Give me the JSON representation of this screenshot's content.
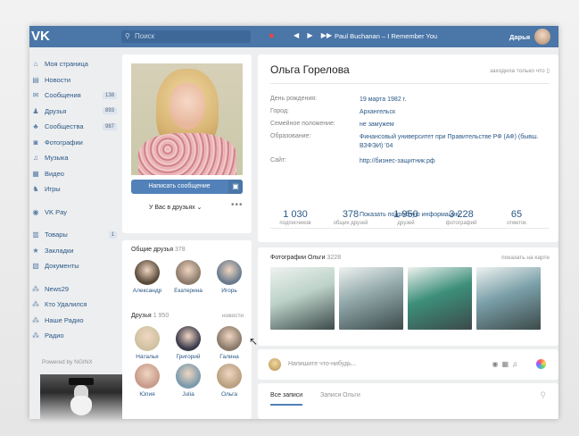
{
  "header": {
    "logo": "VK",
    "search_placeholder": "Поиск",
    "player_controls": [
      "◀",
      "▶",
      "▶▶"
    ],
    "now_playing": "Paul Buchanan – I Remember You",
    "user_name": "Дарья"
  },
  "sidebar": {
    "items": [
      {
        "icon": "home-icon",
        "label": "Моя страница",
        "count": ""
      },
      {
        "icon": "news-icon",
        "label": "Новости",
        "count": ""
      },
      {
        "icon": "messages-icon",
        "label": "Сообщения",
        "count": "138"
      },
      {
        "icon": "friends-icon",
        "label": "Друзья",
        "count": "893"
      },
      {
        "icon": "groups-icon",
        "label": "Сообщества",
        "count": "987"
      },
      {
        "icon": "photos-icon",
        "label": "Фотографии",
        "count": ""
      },
      {
        "icon": "music-icon",
        "label": "Музыка",
        "count": ""
      },
      {
        "icon": "video-icon",
        "label": "Видео",
        "count": ""
      },
      {
        "icon": "games-icon",
        "label": "Игры",
        "count": ""
      }
    ],
    "items2": [
      {
        "icon": "vkpay-icon",
        "label": "VK Pay",
        "count": ""
      }
    ],
    "items3": [
      {
        "icon": "goods-icon",
        "label": "Товары",
        "count": "1"
      },
      {
        "icon": "bookmarks-icon",
        "label": "Закладки",
        "count": ""
      },
      {
        "icon": "documents-icon",
        "label": "Документы",
        "count": ""
      }
    ],
    "items4": [
      {
        "icon": "app-icon",
        "label": "News29",
        "count": ""
      },
      {
        "icon": "app-icon",
        "label": "Кто Удалился",
        "count": ""
      },
      {
        "icon": "app-icon",
        "label": "Наше Радио",
        "count": ""
      },
      {
        "icon": "app-icon",
        "label": "Радио",
        "count": ""
      }
    ],
    "powered": "Powered by NGINX"
  },
  "profile": {
    "message_button": "Написать сообщение",
    "friends_button": "У Вас в друзьях ⌄",
    "more": "•••"
  },
  "common_friends": {
    "title": "Общие друзья",
    "count": "378",
    "items": [
      {
        "name": "Александр",
        "color": "#5a4a3a"
      },
      {
        "name": "Екатерина",
        "color": "#8c7a6a"
      },
      {
        "name": "Игорь",
        "color": "#6a7a8c"
      }
    ]
  },
  "friends": {
    "title": "Друзья",
    "count": "1 950",
    "link": "новости",
    "items": [
      {
        "name": "Наталья",
        "color": "#cfc2a0"
      },
      {
        "name": "Григорий",
        "color": "#3a3a4a"
      },
      {
        "name": "Галина",
        "color": "#8a7a6a"
      },
      {
        "name": "Юлия",
        "color": "#c89a8a"
      },
      {
        "name": "Julia",
        "color": "#7a9aaa"
      },
      {
        "name": "Ольга",
        "color": "#b8a080"
      }
    ]
  },
  "info": {
    "name": "Ольга Горелова",
    "online": "заходила только что",
    "rows": [
      {
        "key": "День рождения:",
        "value": "19 марта 1982 г."
      },
      {
        "key": "Город:",
        "value": "Архангельск"
      },
      {
        "key": "Семейное положение:",
        "value": "не замужем"
      },
      {
        "key": "Образование:",
        "value": "Финансовый университет при Правительстве РФ (АФ) (бывш. ВЗФЭИ) '04"
      },
      {
        "key": "Сайт:",
        "value": "http://бизнес-защитник.рф"
      }
    ],
    "show_more": "Показать подробную информацию"
  },
  "stats": [
    {
      "value": "1 030",
      "label": "подписчиков"
    },
    {
      "value": "378",
      "label": "общих друзей"
    },
    {
      "value": "1 950",
      "label": "друзей"
    },
    {
      "value": "3 228",
      "label": "фотографий"
    },
    {
      "value": "65",
      "label": "отметок"
    }
  ],
  "photos": {
    "title": "Фотографии Ольги",
    "count": "3228",
    "link": "показать на карте",
    "colors": [
      "#bcd2c8",
      "#8fa6a8",
      "#3d8f7a",
      "#7a9fa8"
    ]
  },
  "post": {
    "placeholder": "Напишите что-нибудь..."
  },
  "wall": {
    "tab_all": "Все записи",
    "tab_owner": "Записи Ольги"
  }
}
